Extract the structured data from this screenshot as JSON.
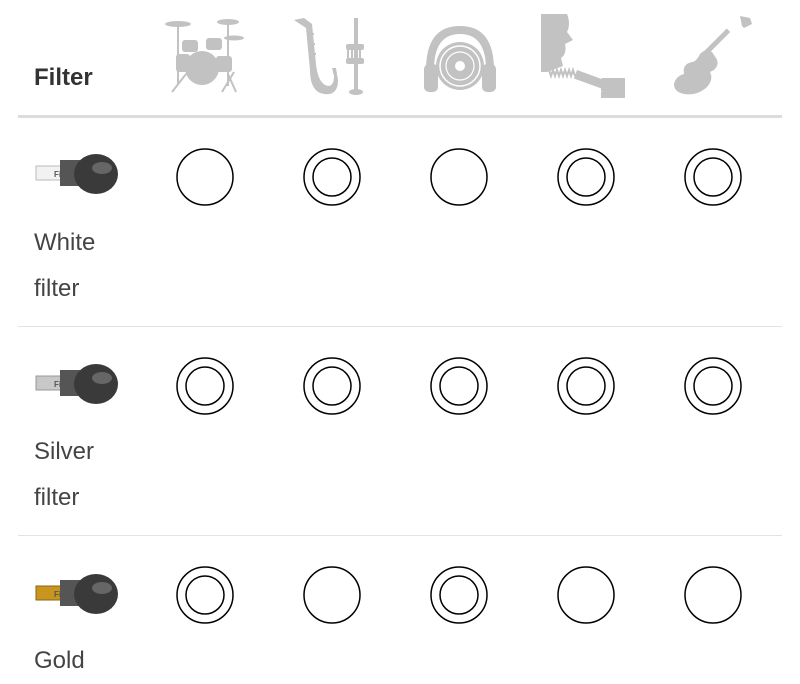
{
  "header": {
    "filter_label": "Filter"
  },
  "instruments": [
    {
      "name": "drums-icon"
    },
    {
      "name": "saxophone-trumpet-icon"
    },
    {
      "name": "headphones-record-icon"
    },
    {
      "name": "singer-microphone-icon"
    },
    {
      "name": "electric-guitar-icon"
    }
  ],
  "rows": [
    {
      "label_line1": "White",
      "label_line2": "filter",
      "tip_color": "#f2f2f2",
      "ratings": [
        1,
        2,
        1,
        2,
        2
      ]
    },
    {
      "label_line1": "Silver",
      "label_line2": "filter",
      "tip_color": "#c8c8c8",
      "ratings": [
        2,
        2,
        2,
        2,
        2
      ]
    },
    {
      "label_line1": "Gold",
      "label_line2": "",
      "tip_color": "#c8961e",
      "ratings": [
        2,
        1,
        2,
        1,
        1
      ]
    }
  ],
  "thumb_text": "Filter",
  "colors": {
    "icon_gray": "#c2c2c2",
    "ring": "#000000",
    "divider": "#dcdcdc"
  }
}
